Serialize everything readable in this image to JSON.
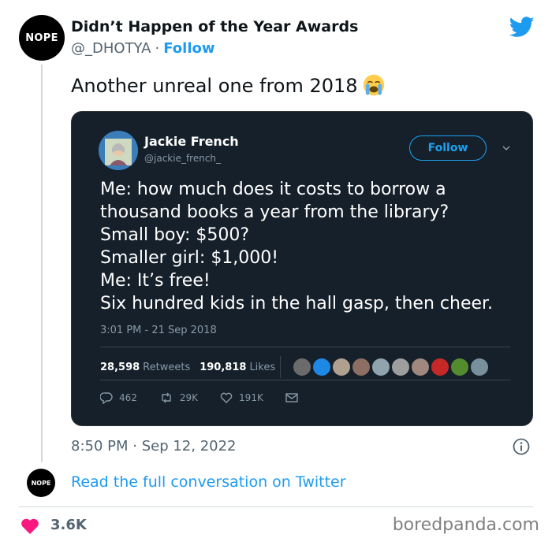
{
  "account": {
    "avatar_text": "NOPE",
    "display_name": "Didn’t Happen of the Year Awards",
    "handle": "@_DHOTYA",
    "separator": "·",
    "follow_label": "Follow"
  },
  "tweet": {
    "text": "Another unreal one from 2018",
    "emoji": "loudly-crying-face-emoji",
    "timestamp": "8:50 PM · Sep 12, 2022"
  },
  "embedded": {
    "name": "Jackie French",
    "handle": "@jackie_french_",
    "follow_label": "Follow",
    "lines": [
      "Me: how much does it costs to  borrow a",
      "thousand books a year from the library?",
      "Small boy: $500?",
      "Smaller girl: $1,000!",
      "Me: It’s free!",
      "Six hundred kids in the hall gasp, then cheer."
    ],
    "time": "3:01 PM - 21 Sep 2018",
    "retweets_count": "28,598",
    "retweets_label": "Retweets",
    "likes_count": "190,818",
    "likes_label": "Likes",
    "replies": "462",
    "retweets_short": "29K",
    "likes_short": "191K",
    "avatar_colors": [
      "#6b6b6b",
      "#1e88e5",
      "#b0a090",
      "#8d6e63",
      "#90a4ae",
      "#9e9e9e",
      "#a1887f",
      "#c62828",
      "#558b2f",
      "#78909c"
    ]
  },
  "footer": {
    "small_avatar_text": "NOPE",
    "read_link": "Read the full conversation on Twitter",
    "like_count": "3.6K",
    "watermark": "boredpanda.com"
  },
  "colors": {
    "twitter_blue": "#1d9bf0",
    "heart": "#f91880",
    "embed_bg": "#15202b"
  }
}
